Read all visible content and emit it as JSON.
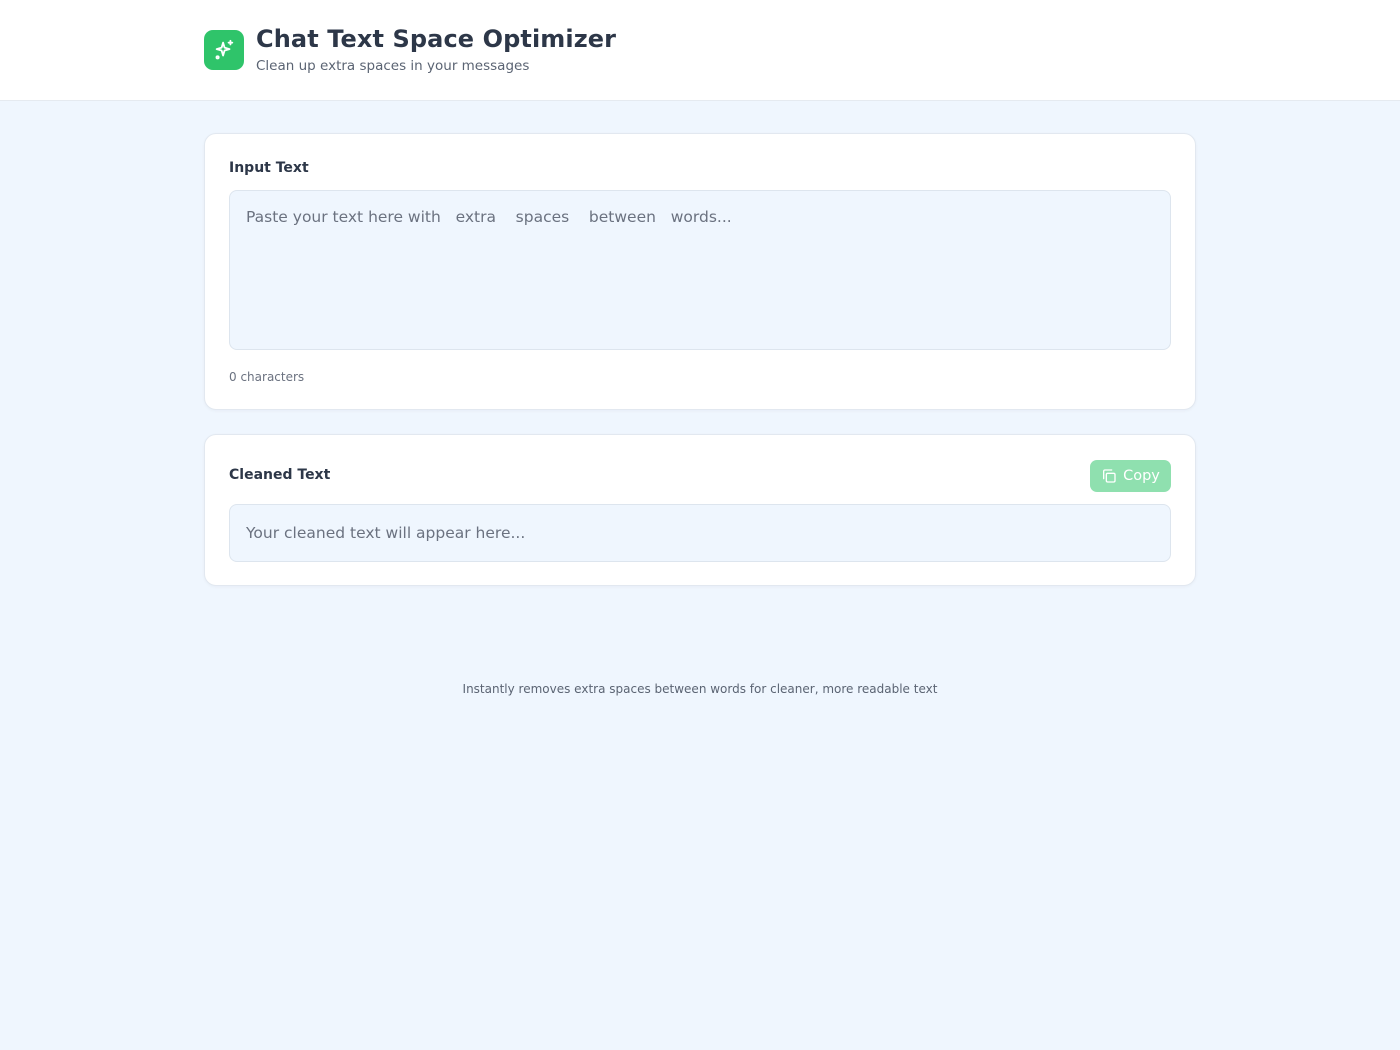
{
  "header": {
    "logo_icon": "sparkles-icon",
    "title": "Chat Text Space Optimizer",
    "subtitle": "Clean up extra spaces in your messages"
  },
  "input_card": {
    "label": "Input Text",
    "placeholder": "Paste your text here with   extra    spaces    between   words...",
    "value": "",
    "char_count": "0 characters"
  },
  "output_card": {
    "label": "Cleaned Text",
    "copy_button": {
      "label": "Copy",
      "icon": "copy-icon",
      "enabled": false
    },
    "placeholder": "Your cleaned text will appear here..."
  },
  "footer": {
    "note": "Instantly removes extra spaces between words for cleaner, more readable text"
  },
  "colors": {
    "accent": "#2fc46a",
    "accent_disabled": "#8fe0af",
    "page_background": "#eff6fe"
  }
}
